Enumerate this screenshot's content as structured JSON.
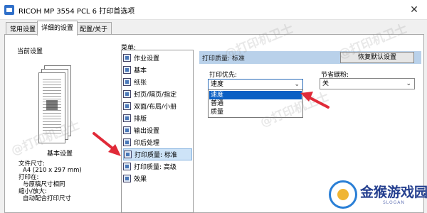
{
  "window": {
    "title": "RICOH MP 3554 PCL 6 打印首选项",
    "close_glyph": "✕"
  },
  "tabs": [
    {
      "label": "常用设置",
      "active": false
    },
    {
      "label": "详细的设置",
      "active": true
    },
    {
      "label": "配置/关于",
      "active": false
    }
  ],
  "left": {
    "current_label": "当前设置",
    "preview_caption": "基本设置",
    "info_lines": [
      "文件尺寸:",
      "A4 (210 x 297 mm)",
      "打印在:",
      "与原稿尺寸相同",
      "缩小/放大:",
      "自动配合打印尺寸"
    ]
  },
  "menu": {
    "label": "菜单:",
    "items": [
      {
        "label": "作业设置"
      },
      {
        "label": "基本"
      },
      {
        "label": "纸张"
      },
      {
        "label": "封页/隔页/指定"
      },
      {
        "label": "双面/布局/小册"
      },
      {
        "label": "排版"
      },
      {
        "label": "输出设置"
      },
      {
        "label": "印后处理"
      },
      {
        "label": "打印质量: 标准",
        "selected": true
      },
      {
        "label": "打印质量: 高级"
      },
      {
        "label": "效果"
      }
    ]
  },
  "panel": {
    "title": "打印质量: 标准",
    "restore_button": "恢复默认设置",
    "print_priority": {
      "label": "打印优先:",
      "value": "速度",
      "options": [
        {
          "label": "速度",
          "highlighted": true
        },
        {
          "label": "普通"
        },
        {
          "label": "质量"
        }
      ]
    },
    "toner_saving": {
      "label": "节省碳粉:",
      "value": "关"
    }
  },
  "icons": {
    "chevron": "⌄",
    "annotation_arrow_color": "#e02a38"
  },
  "watermark": {
    "text": "@打印机卫士"
  },
  "logo": {
    "brand": "金猴游戏园",
    "slogan": "SLOGAN"
  }
}
